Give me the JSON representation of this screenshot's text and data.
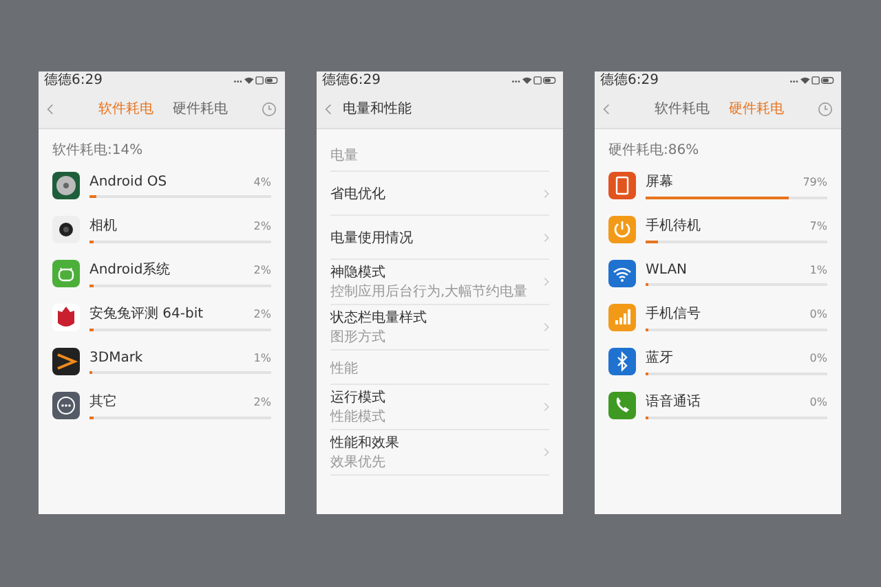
{
  "panels": [
    {
      "kind": "usage",
      "status_bar": {
        "carrier_time": "德德6:29"
      },
      "header": {
        "tabs": [
          {
            "label": "软件耗电",
            "selected": true
          },
          {
            "label": "硬件耗电",
            "selected": false
          }
        ]
      },
      "summary": "软件耗电:14%",
      "items": [
        {
          "name": "Android OS",
          "percent": "4%",
          "level": 0.04
        },
        {
          "name": "相机",
          "percent": "2%",
          "level": 0.02
        },
        {
          "name": "Android系统",
          "percent": "2%",
          "level": 0.02
        },
        {
          "name": "安兔兔评测 64-bit",
          "percent": "2%",
          "level": 0.02
        },
        {
          "name": "3DMark",
          "percent": "1%",
          "level": 0.01
        },
        {
          "name": "其它",
          "percent": "2%",
          "level": 0.02
        }
      ]
    },
    {
      "kind": "settings",
      "status_bar": {
        "carrier_time": "德德6:29"
      },
      "header": {
        "title": "电量和性能"
      },
      "sections": [
        {
          "title": "电量",
          "items": [
            {
              "label": "省电优化"
            },
            {
              "label": "电量使用情况"
            },
            {
              "label": "神隐模式",
              "sublabel": "控制应用后台行为,大幅节约电量"
            },
            {
              "label": "状态栏电量样式",
              "sublabel": "图形方式"
            }
          ]
        },
        {
          "title": "性能",
          "items": [
            {
              "label": "运行模式",
              "sublabel": "性能模式"
            },
            {
              "label": "性能和效果",
              "sublabel": "效果优先"
            }
          ]
        }
      ]
    },
    {
      "kind": "usage",
      "status_bar": {
        "carrier_time": "德德6:29"
      },
      "header": {
        "tabs": [
          {
            "label": "软件耗电",
            "selected": false
          },
          {
            "label": "硬件耗电",
            "selected": true
          }
        ]
      },
      "summary": "硬件耗电:86%",
      "items": [
        {
          "name": "屏幕",
          "percent": "79%",
          "level": 0.79
        },
        {
          "name": "手机待机",
          "percent": "7%",
          "level": 0.07
        },
        {
          "name": "WLAN",
          "percent": "1%",
          "level": 0.01
        },
        {
          "name": "手机信号",
          "percent": "0%",
          "level": 0
        },
        {
          "name": "蓝牙",
          "percent": "0%",
          "level": 0
        },
        {
          "name": "语音通话",
          "percent": "0%",
          "level": 0
        }
      ]
    }
  ]
}
